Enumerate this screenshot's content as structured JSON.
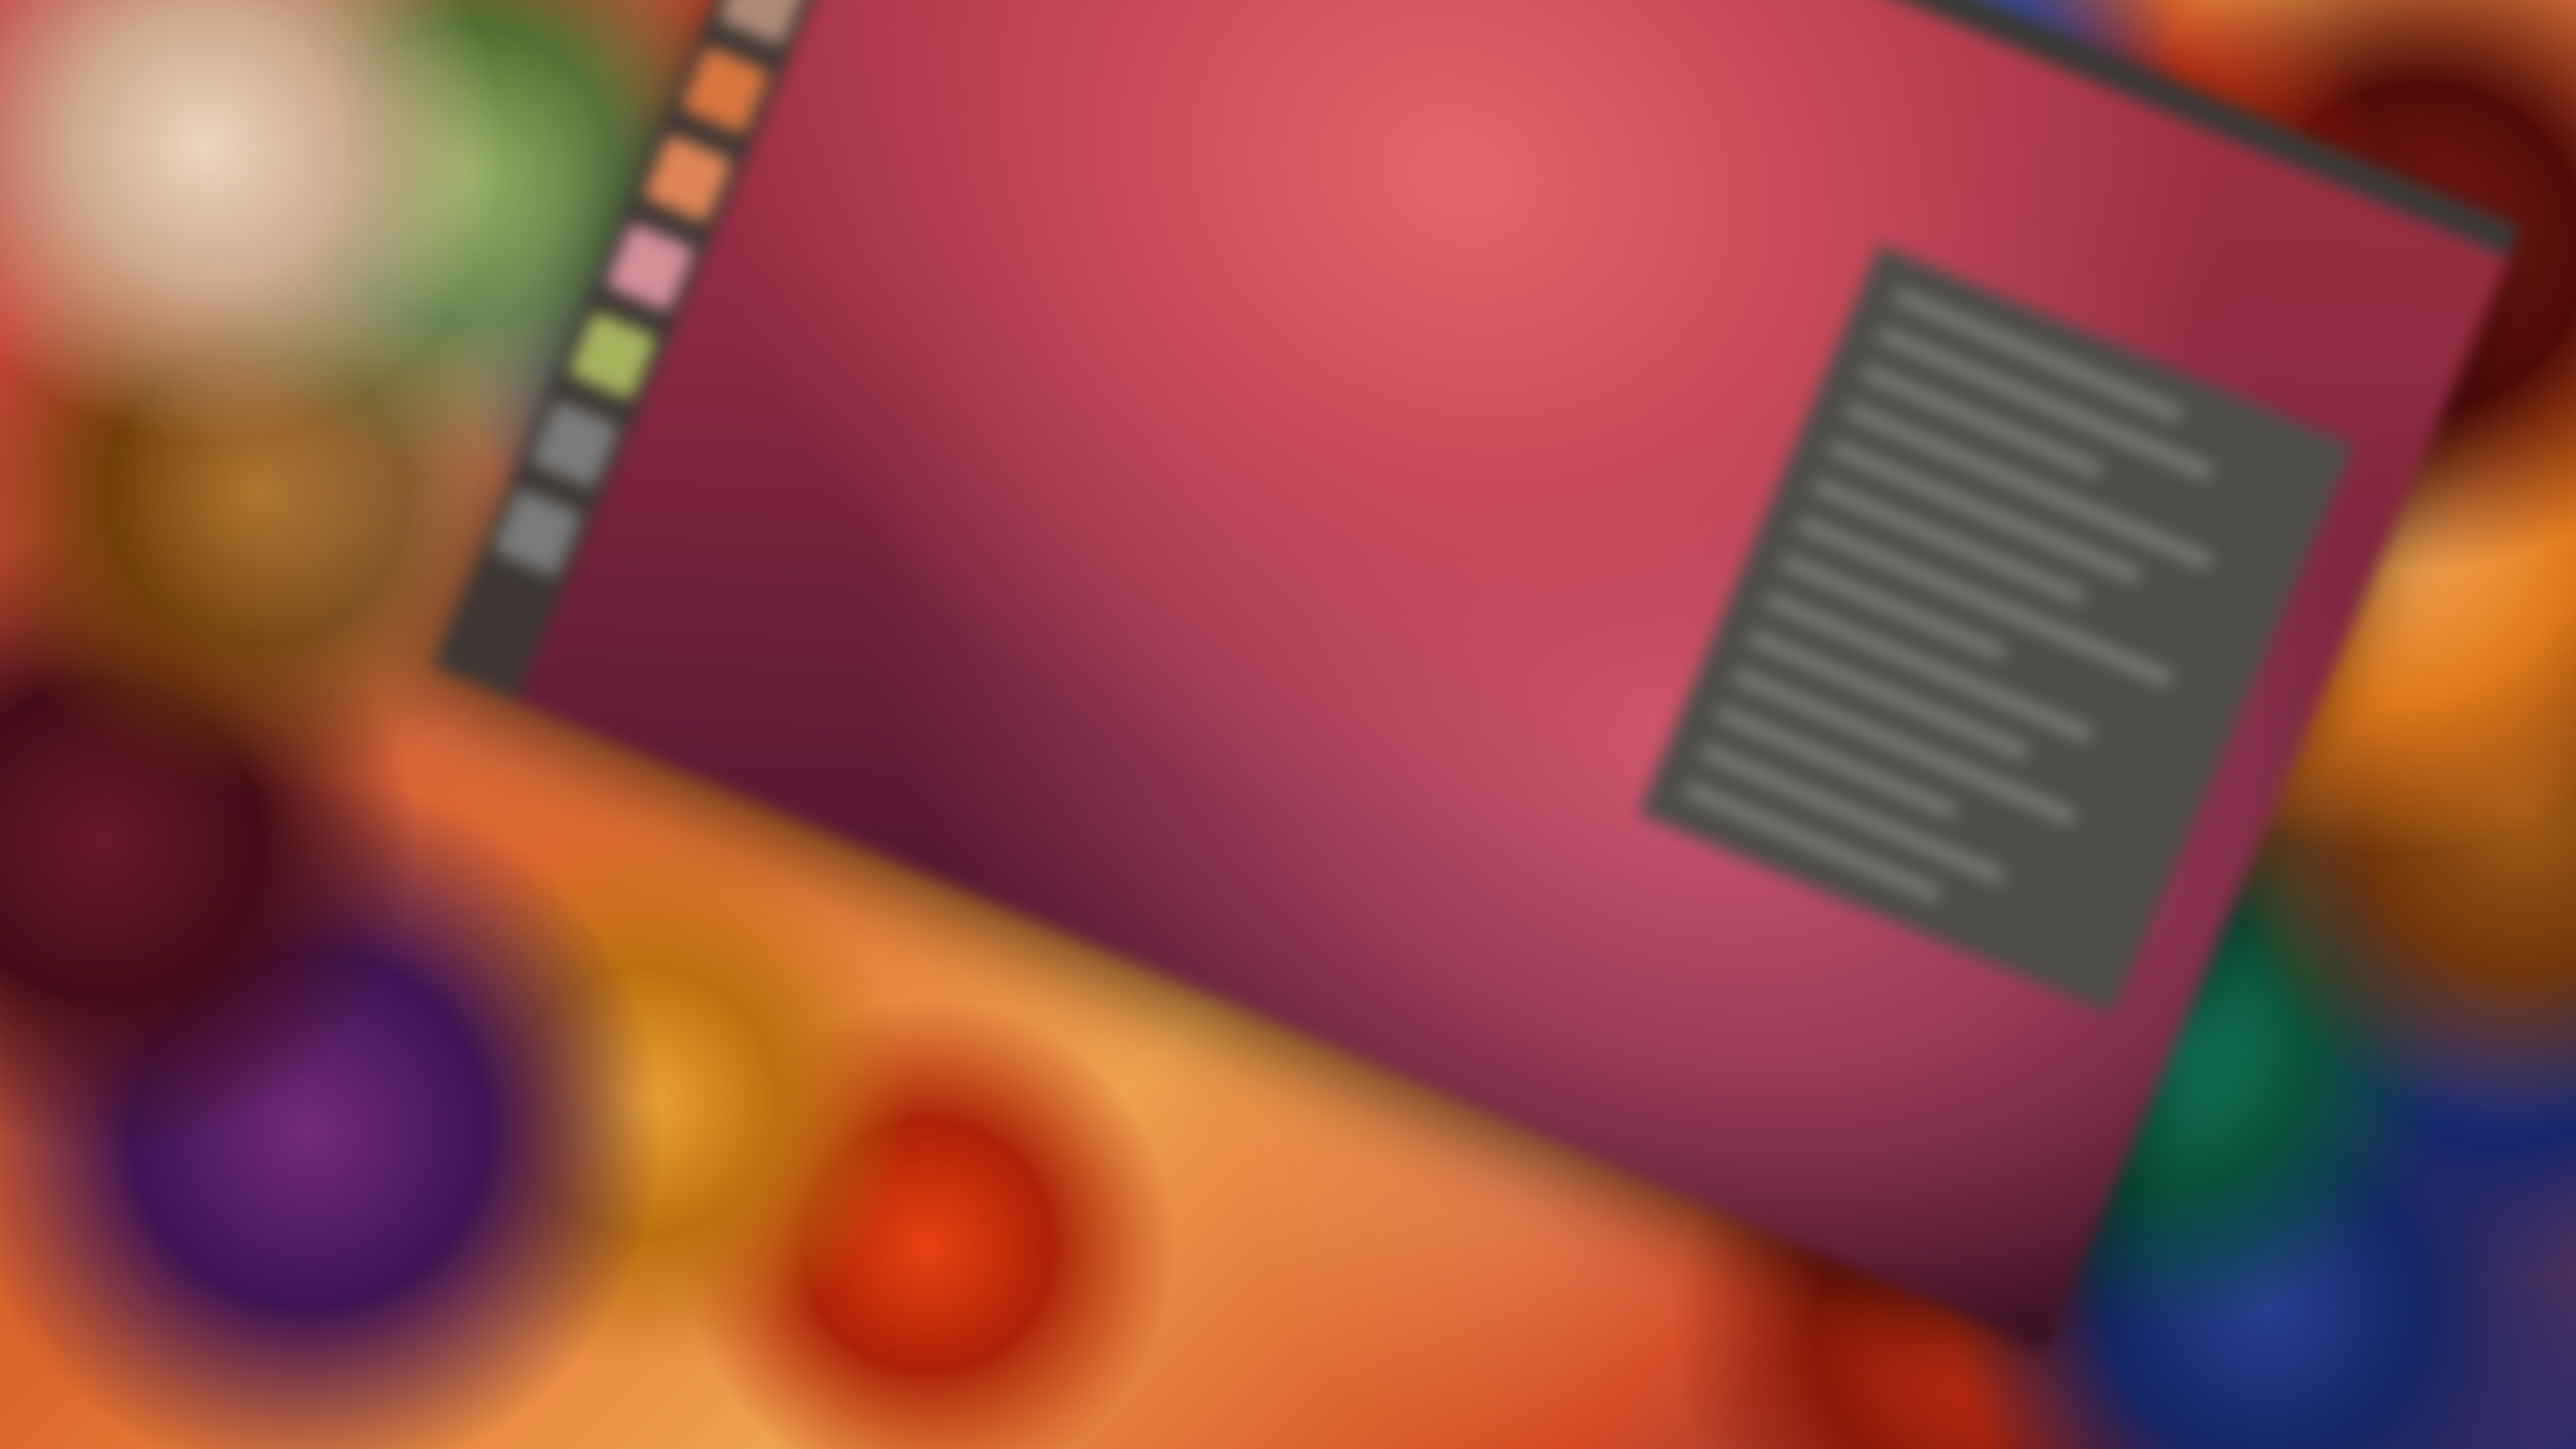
{
  "scene": {
    "title": "",
    "description_visible_text": ""
  },
  "desktop": {
    "menu_bar_text": "",
    "launcher_items": [
      {
        "icon": "folder-icon",
        "color": "#d98f52"
      },
      {
        "icon": "browser-icon",
        "color": "#c88b63"
      },
      {
        "icon": "app-icon",
        "color": "#5d8fc5"
      },
      {
        "icon": "spreadsheet-icon",
        "color": "#58a44c"
      },
      {
        "icon": "document-icon",
        "color": "#b08a78"
      },
      {
        "icon": "presentation-icon",
        "color": "#d7753f"
      },
      {
        "icon": "store-icon",
        "color": "#df8555"
      },
      {
        "icon": "help-icon",
        "color": "#d48f99"
      },
      {
        "icon": "settings-icon",
        "color": "#a7b25d"
      },
      {
        "icon": "workspace-icon",
        "color": "#7b7b7a"
      },
      {
        "icon": "trash-icon",
        "color": "#7a7a79"
      }
    ],
    "dash_menu_items": [
      "",
      "",
      "",
      "",
      "",
      "",
      "",
      "",
      "",
      "",
      "",
      "",
      "",
      ""
    ]
  },
  "colors": {
    "panel": "#4b4a46",
    "launcher": "#3d3633",
    "wallpaper_primary": "#b33943",
    "wallpaper_secondary": "#4d1430"
  }
}
